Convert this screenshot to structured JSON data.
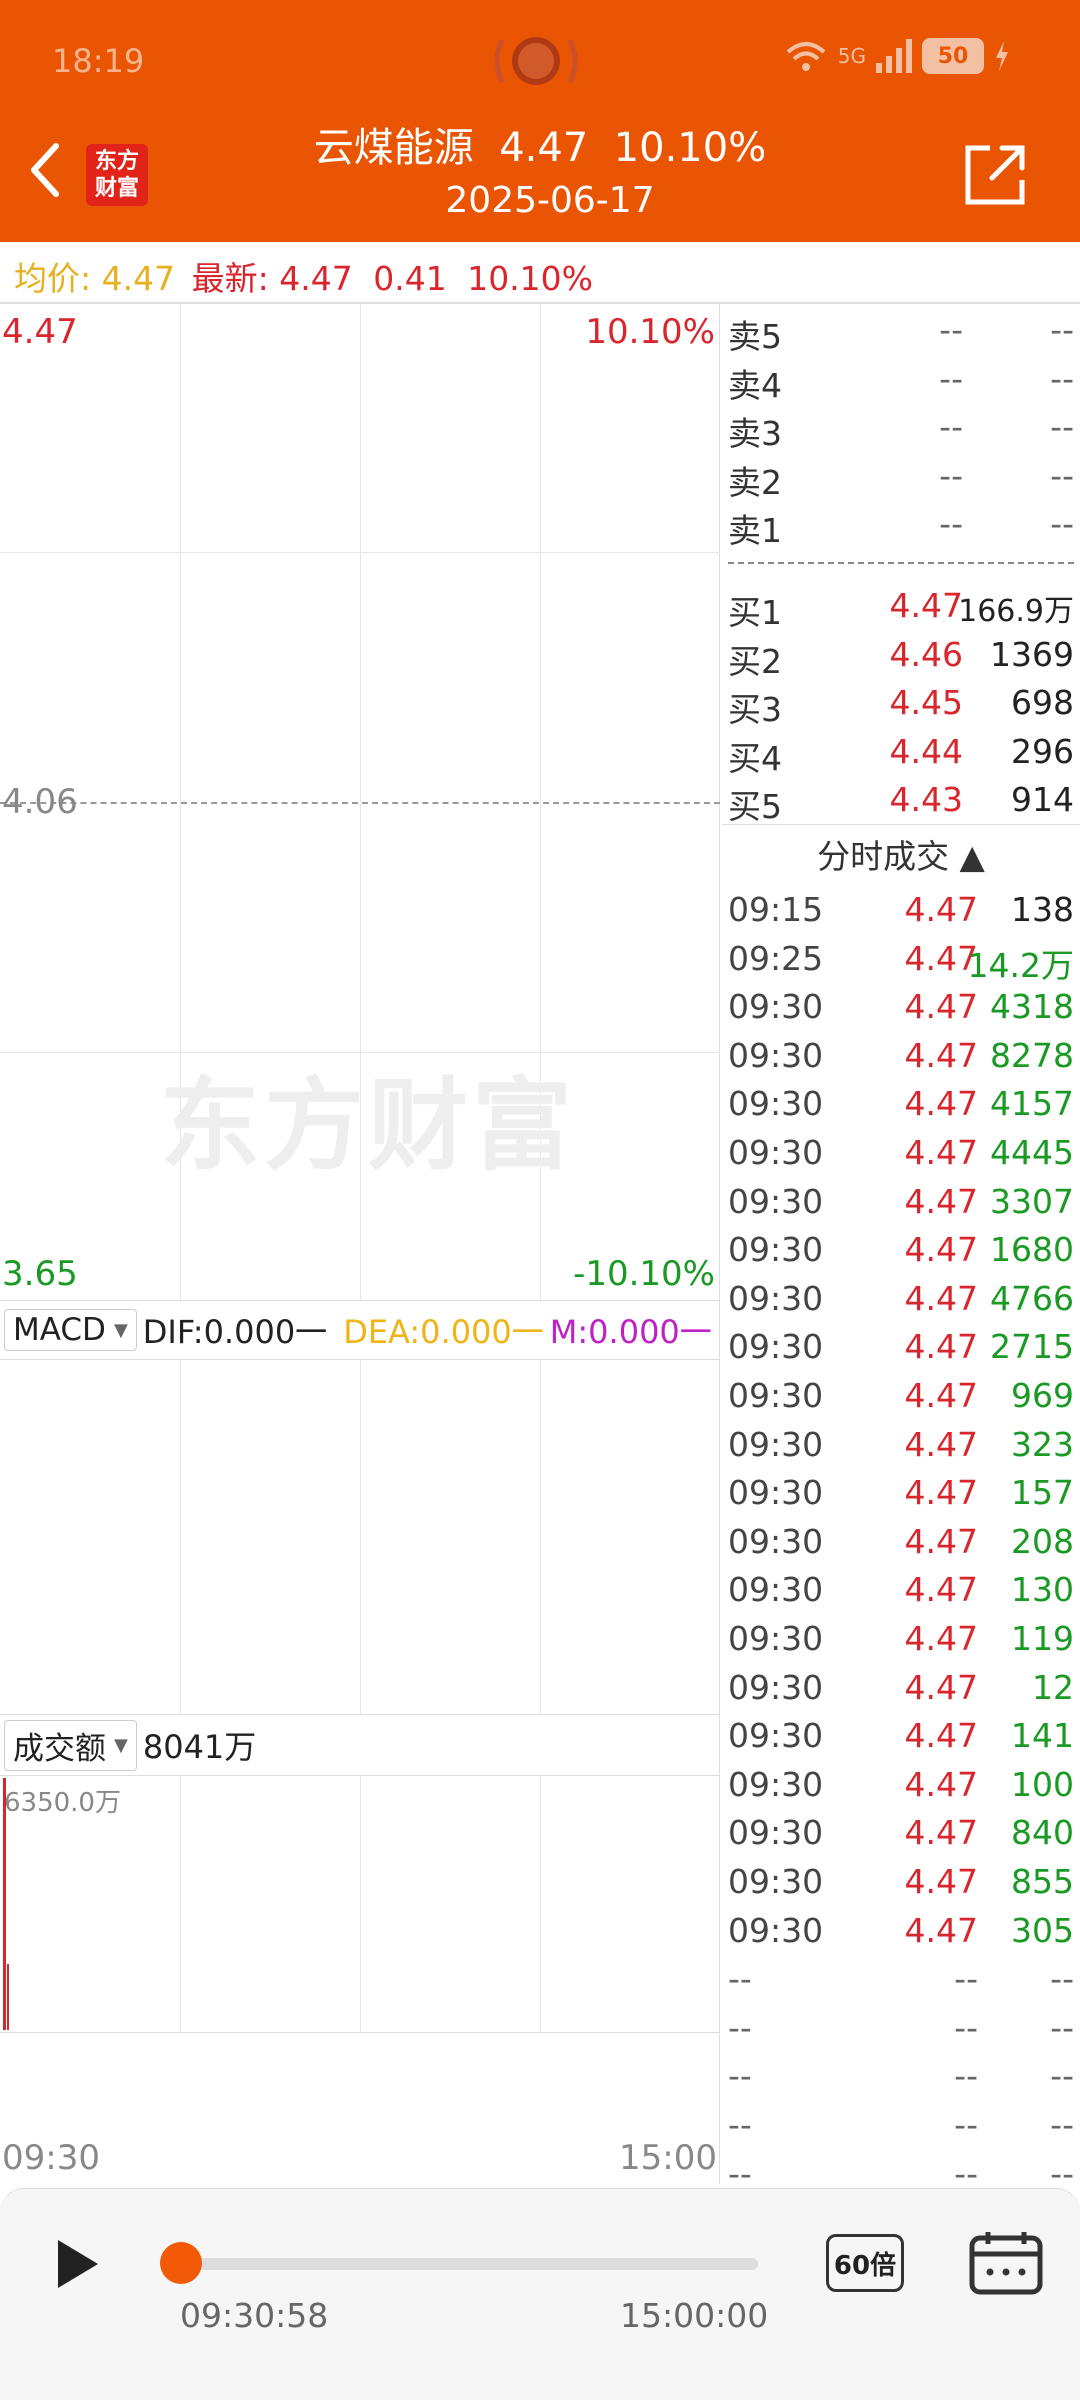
{
  "status": {
    "time": "18:19",
    "network": "5G",
    "battery": "50"
  },
  "header": {
    "title": "云煤能源  4.47  10.10%",
    "date": "2025-06-17",
    "logo_line1": "东方",
    "logo_line2": "财富"
  },
  "infobar": {
    "avg_label": "均价:",
    "avg_value": "4.47",
    "latest_label": "最新:",
    "latest_price": "4.47",
    "change": "0.41",
    "change_pct": "10.10%"
  },
  "chart": {
    "price_high": "4.47",
    "pct_high": "10.10%",
    "price_mid": "4.06",
    "price_low": "3.65",
    "pct_low": "-10.10%",
    "watermark": "东方财富"
  },
  "macd": {
    "select": "MACD",
    "dif": "DIF:0.000一",
    "dea": "DEA:0.000一",
    "m": "M:0.000一"
  },
  "volume": {
    "select": "成交额",
    "total": "8041万",
    "max_label": "6350.0万",
    "time_start": "09:30",
    "time_end": "15:00"
  },
  "orderbook": {
    "sell": [
      {
        "label": "卖5",
        "price": "--",
        "vol": "--"
      },
      {
        "label": "卖4",
        "price": "--",
        "vol": "--"
      },
      {
        "label": "卖3",
        "price": "--",
        "vol": "--"
      },
      {
        "label": "卖2",
        "price": "--",
        "vol": "--"
      },
      {
        "label": "卖1",
        "price": "--",
        "vol": "--"
      }
    ],
    "buy": [
      {
        "label": "买1",
        "price": "4.47",
        "vol": "166.9万"
      },
      {
        "label": "买2",
        "price": "4.46",
        "vol": "1369"
      },
      {
        "label": "买3",
        "price": "4.45",
        "vol": "698"
      },
      {
        "label": "买4",
        "price": "4.44",
        "vol": "296"
      },
      {
        "label": "买5",
        "price": "4.43",
        "vol": "914"
      }
    ]
  },
  "ticks": {
    "header": "分时成交 ▲",
    "rows": [
      {
        "time": "09:15",
        "price": "4.47",
        "vol": "138",
        "vcolor": "#222"
      },
      {
        "time": "09:25",
        "price": "4.47",
        "vol": "14.2万",
        "vcolor": "#1a9a25"
      },
      {
        "time": "09:30",
        "price": "4.47",
        "vol": "4318",
        "vcolor": "#1a9a25"
      },
      {
        "time": "09:30",
        "price": "4.47",
        "vol": "8278",
        "vcolor": "#1a9a25"
      },
      {
        "time": "09:30",
        "price": "4.47",
        "vol": "4157",
        "vcolor": "#1a9a25"
      },
      {
        "time": "09:30",
        "price": "4.47",
        "vol": "4445",
        "vcolor": "#1a9a25"
      },
      {
        "time": "09:30",
        "price": "4.47",
        "vol": "3307",
        "vcolor": "#1a9a25"
      },
      {
        "time": "09:30",
        "price": "4.47",
        "vol": "1680",
        "vcolor": "#1a9a25"
      },
      {
        "time": "09:30",
        "price": "4.47",
        "vol": "4766",
        "vcolor": "#1a9a25"
      },
      {
        "time": "09:30",
        "price": "4.47",
        "vol": "2715",
        "vcolor": "#1a9a25"
      },
      {
        "time": "09:30",
        "price": "4.47",
        "vol": "969",
        "vcolor": "#1a9a25"
      },
      {
        "time": "09:30",
        "price": "4.47",
        "vol": "323",
        "vcolor": "#1a9a25"
      },
      {
        "time": "09:30",
        "price": "4.47",
        "vol": "157",
        "vcolor": "#1a9a25"
      },
      {
        "time": "09:30",
        "price": "4.47",
        "vol": "208",
        "vcolor": "#1a9a25"
      },
      {
        "time": "09:30",
        "price": "4.47",
        "vol": "130",
        "vcolor": "#1a9a25"
      },
      {
        "time": "09:30",
        "price": "4.47",
        "vol": "119",
        "vcolor": "#1a9a25"
      },
      {
        "time": "09:30",
        "price": "4.47",
        "vol": "12",
        "vcolor": "#1a9a25"
      },
      {
        "time": "09:30",
        "price": "4.47",
        "vol": "141",
        "vcolor": "#1a9a25"
      },
      {
        "time": "09:30",
        "price": "4.47",
        "vol": "100",
        "vcolor": "#1a9a25"
      },
      {
        "time": "09:30",
        "price": "4.47",
        "vol": "840",
        "vcolor": "#1a9a25"
      },
      {
        "time": "09:30",
        "price": "4.47",
        "vol": "855",
        "vcolor": "#1a9a25"
      },
      {
        "time": "09:30",
        "price": "4.47",
        "vol": "305",
        "vcolor": "#1a9a25"
      },
      {
        "time": "--",
        "price": "--",
        "vol": "--",
        "vcolor": "#666"
      },
      {
        "time": "--",
        "price": "--",
        "vol": "--",
        "vcolor": "#666"
      },
      {
        "time": "--",
        "price": "--",
        "vol": "--",
        "vcolor": "#666"
      },
      {
        "time": "--",
        "price": "--",
        "vol": "--",
        "vcolor": "#666"
      },
      {
        "time": "--",
        "price": "--",
        "vol": "--",
        "vcolor": "#666"
      }
    ]
  },
  "player": {
    "current": "09:30:58",
    "end": "15:00:00",
    "speed": "60倍",
    "progress": 0.0
  }
}
